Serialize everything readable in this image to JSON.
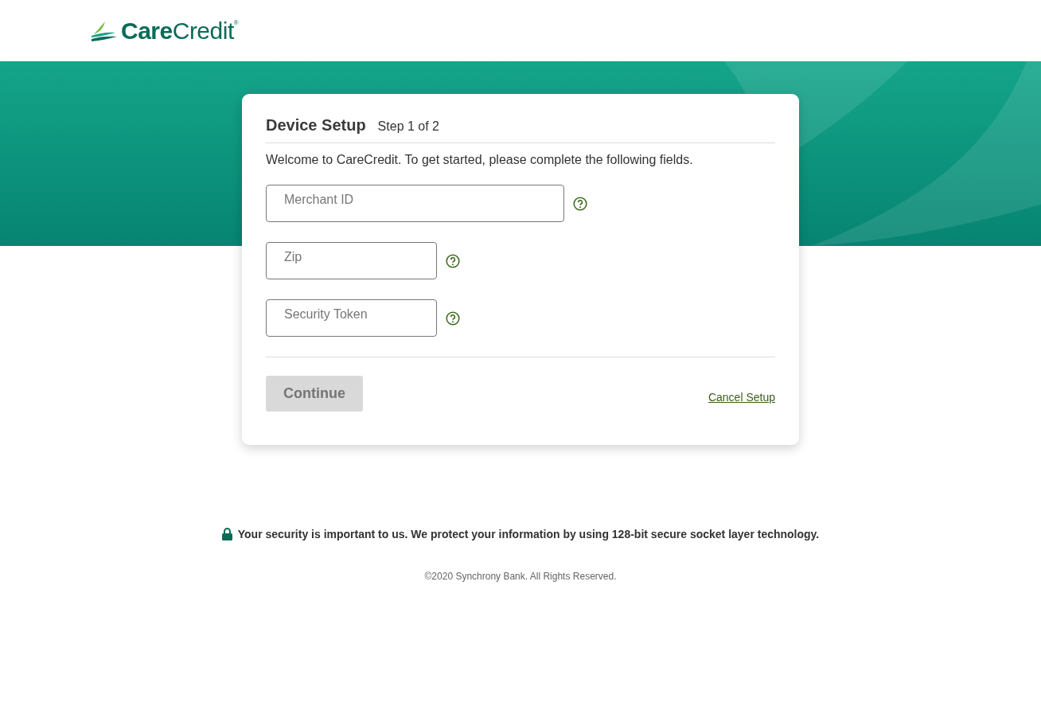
{
  "header": {
    "logo": "**Care**Credit$^{®}$"
  },
  "card": {
    "title": "Device Setup",
    "step": "Step 1 of 2",
    "intro": "Welcome to CareCredit. To get started, please complete the following fields.",
    "fields": [
      {
        "placeholder": "Merchant ID",
        "kind": "wide"
      },
      {
        "placeholder": "Zip",
        "kind": "narrow"
      },
      {
        "placeholder": "Security Token",
        "kind": "narrow"
      }
    ],
    "continue_button": {
      "label": "Continue",
      "disabled": true
    },
    "cancel_link": "Cancel Setup"
  },
  "footer": {
    "security": "Your security is important to us. We protect your information by using 128-bit secure socket layer technology.",
    "copyright": "©2020 Synchrony Bank. All Rights Reserved."
  }
}
